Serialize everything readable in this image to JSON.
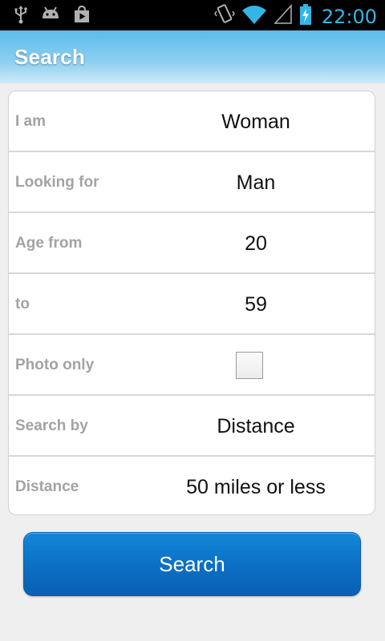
{
  "status_bar": {
    "clock": "22:00",
    "icons": [
      "usb-icon",
      "android-debug-icon",
      "play-store-icon",
      "vibrate-icon",
      "wifi-icon",
      "signal-icon",
      "battery-charging-icon"
    ],
    "accent_color": "#33b5e5"
  },
  "header": {
    "title": "Search"
  },
  "form": {
    "rows": [
      {
        "label": "I am",
        "value": "Woman"
      },
      {
        "label": "Looking for",
        "value": "Man"
      },
      {
        "label": "Age from",
        "value": "20"
      },
      {
        "label": "to",
        "value": "59"
      },
      {
        "label": "Photo only",
        "checked": false
      },
      {
        "label": "Search by",
        "value": "Distance"
      },
      {
        "label": "Distance",
        "value": "50 miles or less"
      }
    ]
  },
  "search_button": {
    "label": "Search",
    "color": "#0b6fc3"
  }
}
